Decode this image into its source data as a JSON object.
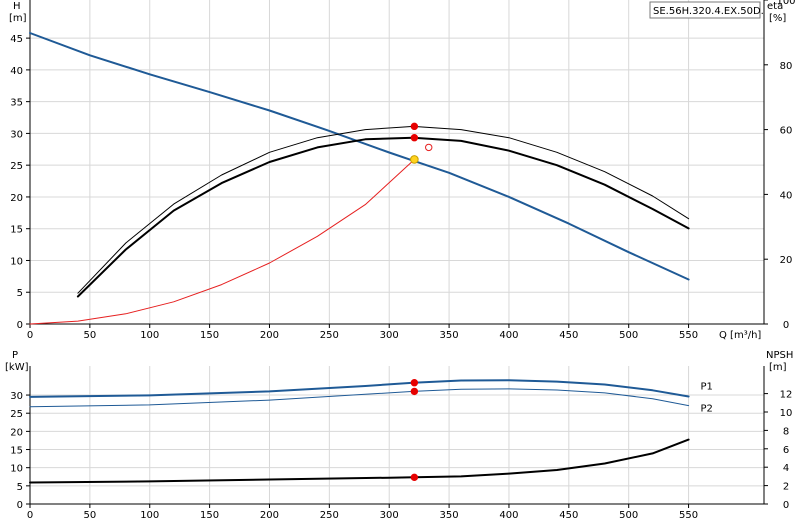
{
  "model_label": "SE.56H.320.4.EX.50D.",
  "colors": {
    "blue": "#1f5a96",
    "black": "#000000",
    "red_curve": "#e62020",
    "red_point": "#e60000",
    "yellow_point": "#ffd21e",
    "grid": "#d8d8d8"
  },
  "chart_data": [
    {
      "type": "line",
      "panel": "top",
      "xlabel": "Q [m³/h]",
      "x_ticks": [
        0,
        50,
        100,
        150,
        200,
        250,
        300,
        350,
        400,
        450,
        500,
        550
      ],
      "xlim": [
        0,
        613
      ],
      "left_axis": {
        "label_top": "H",
        "label_bottom": "[m]",
        "ticks": [
          0,
          5,
          10,
          15,
          20,
          25,
          30,
          35,
          40,
          45
        ],
        "ylim": [
          0,
          51
        ]
      },
      "right_axis": {
        "label_top": "eta",
        "label_bottom": "[%]",
        "ticks": [
          0,
          20,
          40,
          60,
          80,
          100
        ],
        "ylim": [
          0,
          100
        ]
      },
      "series": [
        {
          "color": "blue",
          "width": 2,
          "axis": "left",
          "x": [
            0,
            50,
            100,
            150,
            200,
            250,
            300,
            320,
            350,
            400,
            450,
            500,
            550
          ],
          "y": [
            45.8,
            42.3,
            39.3,
            36.5,
            33.6,
            30.4,
            27.0,
            25.7,
            23.8,
            20.0,
            15.8,
            11.3,
            7.0
          ]
        },
        {
          "color": "black",
          "width": 2,
          "axis": "right",
          "x": [
            40,
            80,
            120,
            160,
            200,
            240,
            280,
            320,
            360,
            400,
            440,
            480,
            520,
            550
          ],
          "y": [
            8.5,
            23,
            35,
            43.5,
            50,
            54.5,
            57,
            57.5,
            56.5,
            53.5,
            49,
            43,
            35.5,
            29.5
          ]
        },
        {
          "color": "black",
          "width": 1,
          "axis": "right",
          "x": [
            40,
            80,
            120,
            160,
            200,
            240,
            280,
            320,
            360,
            400,
            440,
            480,
            520,
            550
          ],
          "y": [
            9.5,
            25,
            37,
            46,
            53,
            57.5,
            60,
            61,
            60,
            57.5,
            53,
            47,
            39.5,
            32.5
          ]
        },
        {
          "color": "red_curve",
          "width": 1,
          "axis": "left",
          "x": [
            0,
            40,
            80,
            120,
            160,
            200,
            240,
            280,
            321
          ],
          "y": [
            0,
            0.45,
            1.6,
            3.5,
            6.2,
            9.6,
            13.8,
            18.8,
            25.9
          ]
        }
      ],
      "points": [
        {
          "x": 321,
          "y": 25.9,
          "axis": "left",
          "color": "yellow_point",
          "r": 3.8
        },
        {
          "x": 321,
          "y": 61,
          "axis": "right",
          "color": "red_point",
          "r": 3.2
        },
        {
          "x": 321,
          "y": 57.5,
          "axis": "right",
          "color": "red_point",
          "r": 3.2
        }
      ],
      "markers": [
        {
          "x": 333,
          "y": 27.8,
          "axis": "left",
          "color": "red_curve",
          "r": 3.2,
          "hollow": true
        }
      ]
    },
    {
      "type": "line",
      "panel": "bottom",
      "x_ticks": [
        0,
        50,
        100,
        150,
        200,
        250,
        300,
        350,
        400,
        450,
        500,
        550
      ],
      "xlim": [
        0,
        613
      ],
      "left_axis": {
        "label_top": "P",
        "label_bottom": "[kW]",
        "ticks": [
          0,
          5,
          10,
          15,
          20,
          25,
          30
        ],
        "ylim": [
          0,
          38
        ]
      },
      "right_axis": {
        "label_top": "NPSH",
        "label_bottom": "[m]",
        "ticks": [
          0,
          2,
          4,
          6,
          8,
          10,
          12
        ],
        "ylim": [
          0,
          15
        ]
      },
      "series": [
        {
          "name": "P1",
          "color": "blue",
          "width": 2,
          "axis": "left",
          "x": [
            0,
            100,
            200,
            280,
            320,
            360,
            400,
            440,
            480,
            520,
            550
          ],
          "y": [
            29.5,
            29.9,
            31.0,
            32.5,
            33.4,
            34.0,
            34.1,
            33.7,
            32.9,
            31.3,
            29.6
          ]
        },
        {
          "name": "P2",
          "color": "blue",
          "width": 1,
          "axis": "left",
          "x": [
            0,
            100,
            200,
            280,
            320,
            360,
            400,
            440,
            480,
            520,
            550
          ],
          "y": [
            26.8,
            27.3,
            28.6,
            30.2,
            31.0,
            31.6,
            31.7,
            31.4,
            30.6,
            29.0,
            27.1
          ]
        },
        {
          "color": "black",
          "width": 2,
          "axis": "right",
          "x": [
            0,
            100,
            200,
            300,
            321,
            360,
            400,
            440,
            480,
            520,
            550
          ],
          "y": [
            2.34,
            2.46,
            2.66,
            2.86,
            2.9,
            3.0,
            3.3,
            3.7,
            4.4,
            5.5,
            7.0
          ]
        }
      ],
      "points": [
        {
          "x": 321,
          "y": 33.4,
          "axis": "left",
          "color": "red_point",
          "r": 3.2
        },
        {
          "x": 321,
          "y": 31.0,
          "axis": "left",
          "color": "red_point",
          "r": 3.2
        },
        {
          "x": 321,
          "y": 2.9,
          "axis": "right",
          "color": "red_point",
          "r": 3.2
        }
      ],
      "series_labels": [
        {
          "text": "P1",
          "x": 560,
          "y": 31.5,
          "axis": "left"
        },
        {
          "text": "P2",
          "x": 560,
          "y": 25.5,
          "axis": "left"
        }
      ]
    }
  ]
}
